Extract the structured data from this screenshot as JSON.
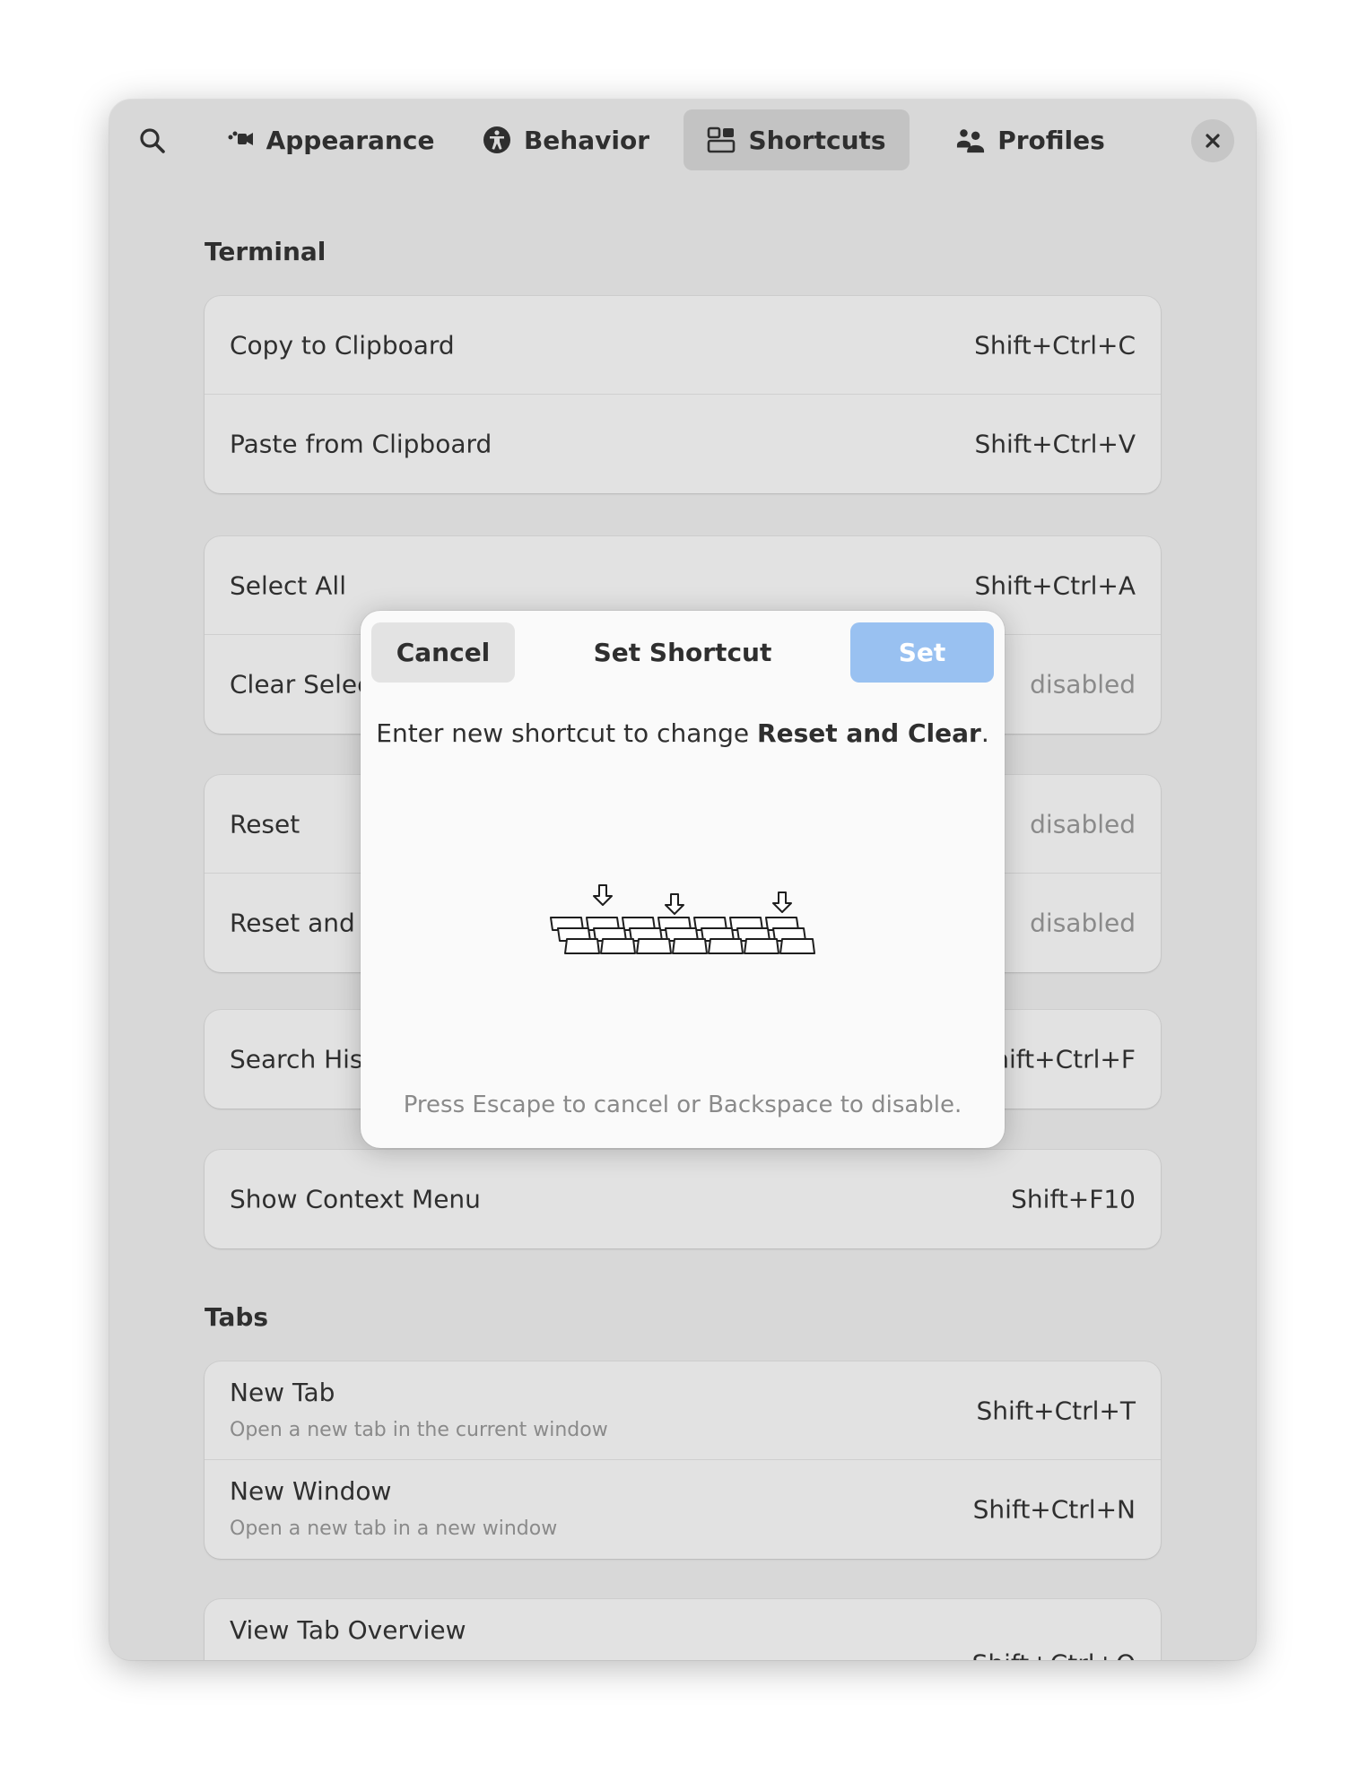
{
  "header": {
    "search_icon": "search-icon",
    "tabs": [
      {
        "label": "Appearance",
        "icon": "appearance-icon",
        "active": false
      },
      {
        "label": "Behavior",
        "icon": "accessibility-icon",
        "active": false
      },
      {
        "label": "Shortcuts",
        "icon": "shortcuts-icon",
        "active": true
      },
      {
        "label": "Profiles",
        "icon": "profiles-icon",
        "active": false
      }
    ],
    "close_icon": "close-icon"
  },
  "sections": {
    "terminal_title": "Terminal",
    "tabs_title": "Tabs"
  },
  "shortcuts": {
    "copy": {
      "label": "Copy to Clipboard",
      "accel": "Shift+Ctrl+C"
    },
    "paste": {
      "label": "Paste from Clipboard",
      "accel": "Shift+Ctrl+V"
    },
    "select_all": {
      "label": "Select All",
      "accel": "Shift+Ctrl+A"
    },
    "clear_selection": {
      "label": "Clear Selec",
      "accel": "disabled"
    },
    "reset": {
      "label": "Reset",
      "accel": "disabled"
    },
    "reset_clear": {
      "label": "Reset and C",
      "accel": "disabled"
    },
    "search_history": {
      "label": "Search Hist",
      "accel": "hift+Ctrl+F"
    },
    "context_menu": {
      "label": "Show Context Menu",
      "accel": "Shift+F10"
    },
    "new_tab": {
      "label": "New Tab",
      "sub": "Open a new tab in the current window",
      "accel": "Shift+Ctrl+T"
    },
    "new_window": {
      "label": "New Window",
      "sub": "Open a new tab in a new window",
      "accel": "Shift+Ctrl+N"
    },
    "tab_overview": {
      "label": "View Tab Overview",
      "accel": "Shift+Ctrl+O"
    }
  },
  "dialog": {
    "cancel_label": "Cancel",
    "title": "Set Shortcut",
    "set_label": "Set",
    "message_prefix": "Enter new shortcut to change ",
    "message_target": "Reset and Clear",
    "message_suffix": ".",
    "hint": "Press Escape to cancel or Backspace to disable.",
    "illustration": "keyboard-keys-illustration"
  },
  "colors": {
    "window_bg": "#d8d8d8",
    "row_bg": "#e2e2e2",
    "dialog_bg": "#fafafa",
    "set_button": "#99c1f1",
    "active_tab": "#c3c3c3"
  }
}
